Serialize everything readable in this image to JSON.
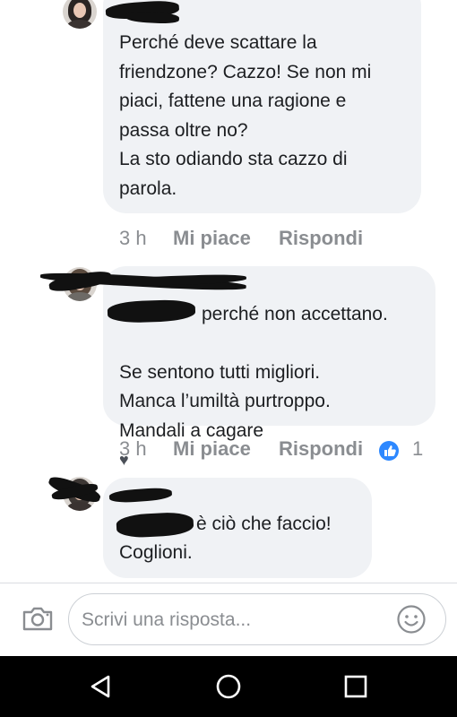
{
  "comments": [
    {
      "author": "",
      "text": "Perché deve scattare la\nfriendzone? Cazzo! Se non mi\npiaci, fattene una ragione e\npassa oltre no?\nLa sto odiando sta cazzo di\nparola.",
      "time": "3 h",
      "like_label": "Mi piace",
      "reply_label": "Rispondi"
    },
    {
      "author": "",
      "text_after_mention": "perché non accettano.",
      "text_rest": "Se sentono tutti migliori.\nManca l’umiltà purtroppo.\nMandali a cagare",
      "heart_glyph": "♥",
      "time": "3 h",
      "like_label": "Mi piace",
      "reply_label": "Rispondi",
      "reaction_count": "1"
    },
    {
      "author": "",
      "text_after_mention": "è ciò che faccio!",
      "text_rest": "Coglioni."
    }
  ],
  "composer": {
    "placeholder": "Scrivi una risposta...",
    "camera_icon": "camera-icon",
    "emoji_icon": "emoji-icon"
  },
  "navbar": {
    "back_icon": "back-triangle-icon",
    "home_icon": "home-circle-icon",
    "recents_icon": "recents-square-icon"
  },
  "colors": {
    "bubble": "#f0f2f5",
    "meta_text": "#8a8d91",
    "like_blue": "#2d88ff",
    "nav_bar": "#000000"
  }
}
